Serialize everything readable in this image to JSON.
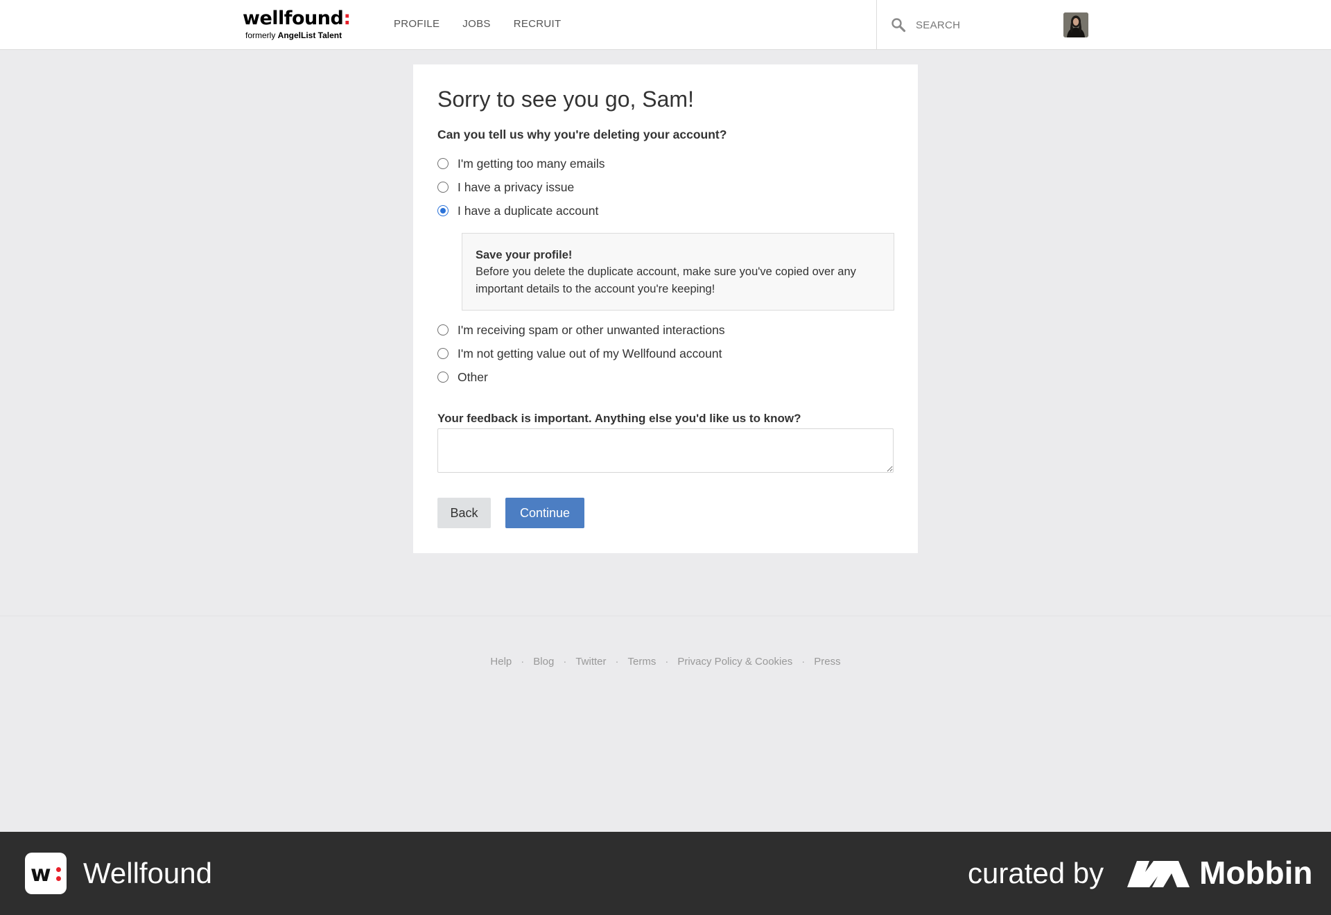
{
  "header": {
    "logo_main": "wellfound",
    "logo_colon": ":",
    "logo_sub_prefix": "formerly ",
    "logo_sub_brand": "AngelList Talent",
    "nav": [
      "PROFILE",
      "JOBS",
      "RECRUIT"
    ],
    "search_placeholder": "SEARCH"
  },
  "form": {
    "title": "Sorry to see you go, Sam!",
    "question": "Can you tell us why you're deleting your account?",
    "options": [
      "I'm getting too many emails",
      "I have a privacy issue",
      "I have a duplicate account",
      "I'm receiving spam or other unwanted interactions",
      "I'm not getting value out of my Wellfound account",
      "Other"
    ],
    "selected_option": "I have a duplicate account",
    "info_title": "Save your profile!",
    "info_text": "Before you delete the duplicate account, make sure you've copied over any important details to the account you're keeping!",
    "feedback_label": "Your feedback is important. Anything else you'd like us to know?",
    "feedback_value": "",
    "back_label": "Back",
    "continue_label": "Continue"
  },
  "footer": {
    "links": [
      "Help",
      "Blog",
      "Twitter",
      "Terms",
      "Privacy Policy & Cookies",
      "Press"
    ],
    "separator": "·"
  },
  "banner": {
    "brand_badge": "w",
    "brand_name": "Wellfound",
    "curated_by": "curated by",
    "mobbin": "Mobbin"
  },
  "colors": {
    "accent_red": "#e8202a",
    "radio_blue": "#2a72d8",
    "continue_button": "#4c7ec3",
    "banner_bg": "#2e2e2e"
  },
  "icons": {
    "search": "search-icon",
    "avatar": "user-avatar"
  }
}
